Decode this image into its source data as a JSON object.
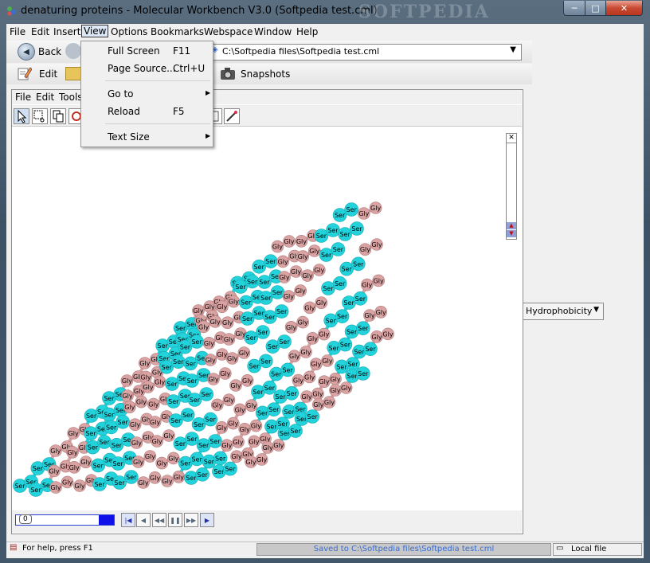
{
  "window": {
    "title": "denaturing proteins - Molecular Workbench V3.0 (Softpedia test.cml)",
    "watermark": "SOFTPEDIA",
    "controls": {
      "minimize": "─",
      "maximize": "□",
      "close": "✕"
    }
  },
  "menubar": [
    "File",
    "Edit",
    "Insert",
    "View",
    "Options",
    "Bookmarks",
    "Webspace",
    "Window",
    "Help"
  ],
  "toolbar": {
    "back_label": "Back",
    "edit_label": "Edit",
    "snapshots_label": "Snapshots",
    "address": "C:\\Softpedia files\\Softpedia test.cml"
  },
  "view_menu": {
    "items": [
      {
        "label": "Full Screen",
        "shortcut": "F11"
      },
      {
        "label": "Page Source...",
        "shortcut": "Ctrl+U"
      },
      {
        "label": "Go to",
        "submenu": true
      },
      {
        "label": "Reload",
        "shortcut": "F5"
      },
      {
        "label": "Text Size",
        "submenu": true
      }
    ]
  },
  "inner_app": {
    "menu": [
      "File",
      "Edit",
      "Tools"
    ],
    "slider_value": "0",
    "property_select": "Hydrophobicity"
  },
  "molecule": {
    "labels": [
      "Gly",
      "Ser"
    ],
    "colors": {
      "gly": "#d9a3a3",
      "ser": "#22d3dc"
    }
  },
  "statusbar": {
    "help": "For help, press F1",
    "message": "Saved to C:\\Softpedia files\\Softpedia test.cml",
    "location": "Local file"
  }
}
